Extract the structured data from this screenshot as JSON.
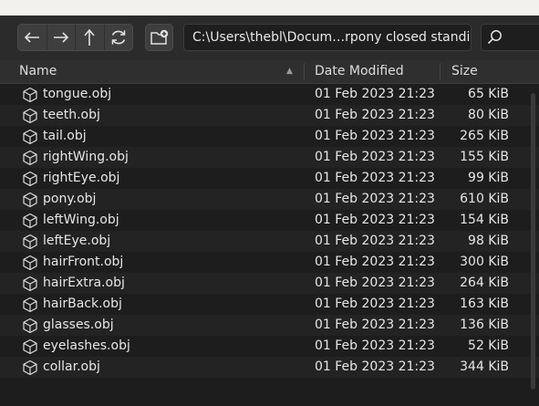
{
  "toolbar": {
    "path_value": "C:\\Users\\thebl\\Docum…rpony closed standing\\",
    "back_icon": "arrow-left-icon",
    "forward_icon": "arrow-right-icon",
    "up_icon": "arrow-up-icon",
    "refresh_icon": "refresh-icon",
    "new_folder_icon": "new-folder-icon",
    "search_icon": "search-icon"
  },
  "columns": {
    "name": "Name",
    "date": "Date Modified",
    "size": "Size"
  },
  "files": [
    {
      "name": "tongue.obj",
      "date": "01 Feb 2023 21:23",
      "size": "65 KiB"
    },
    {
      "name": "teeth.obj",
      "date": "01 Feb 2023 21:23",
      "size": "80 KiB"
    },
    {
      "name": "tail.obj",
      "date": "01 Feb 2023 21:23",
      "size": "265 KiB"
    },
    {
      "name": "rightWing.obj",
      "date": "01 Feb 2023 21:23",
      "size": "155 KiB"
    },
    {
      "name": "rightEye.obj",
      "date": "01 Feb 2023 21:23",
      "size": "99 KiB"
    },
    {
      "name": "pony.obj",
      "date": "01 Feb 2023 21:23",
      "size": "610 KiB"
    },
    {
      "name": "leftWing.obj",
      "date": "01 Feb 2023 21:23",
      "size": "154 KiB"
    },
    {
      "name": "leftEye.obj",
      "date": "01 Feb 2023 21:23",
      "size": "98 KiB"
    },
    {
      "name": "hairFront.obj",
      "date": "01 Feb 2023 21:23",
      "size": "300 KiB"
    },
    {
      "name": "hairExtra.obj",
      "date": "01 Feb 2023 21:23",
      "size": "264 KiB"
    },
    {
      "name": "hairBack.obj",
      "date": "01 Feb 2023 21:23",
      "size": "163 KiB"
    },
    {
      "name": "glasses.obj",
      "date": "01 Feb 2023 21:23",
      "size": "136 KiB"
    },
    {
      "name": "eyelashes.obj",
      "date": "01 Feb 2023 21:23",
      "size": "52 KiB"
    },
    {
      "name": "collar.obj",
      "date": "01 Feb 2023 21:23",
      "size": "344 KiB"
    }
  ],
  "file_icon": "mesh-cube-icon"
}
